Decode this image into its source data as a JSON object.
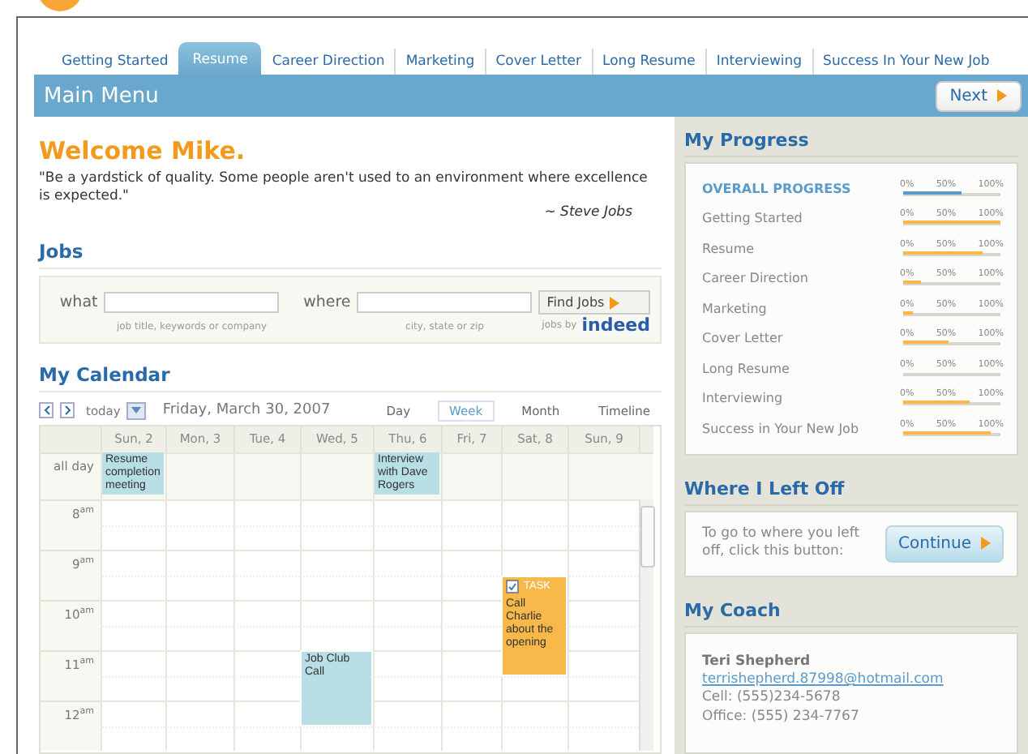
{
  "tabs": [
    {
      "label": "Getting Started",
      "selected": false
    },
    {
      "label": "Resume",
      "selected": true
    },
    {
      "label": "Career Direction",
      "selected": false
    },
    {
      "label": "Marketing",
      "selected": false
    },
    {
      "label": "Cover Letter",
      "selected": false
    },
    {
      "label": "Long Resume",
      "selected": false
    },
    {
      "label": "Interviewing",
      "selected": false
    },
    {
      "label": "Success In Your New Job",
      "selected": false
    }
  ],
  "menu_bar": {
    "title": "Main Menu",
    "next_button": "Next"
  },
  "welcome": {
    "title": "Welcome Mike.",
    "quote": "\"Be a yardstick of quality. Some people aren't used to an environment where excellence is expected.\"",
    "author": "~ Steve Jobs"
  },
  "jobs": {
    "title": "Jobs",
    "what": {
      "label": "what",
      "hint": "job title, keywords or company"
    },
    "where": {
      "label": "where",
      "hint": "city, state or zip"
    },
    "find_button": "Find Jobs",
    "jobs_by": "jobs by",
    "provider": "indeed"
  },
  "calendar": {
    "title": "My Calendar",
    "today": "today",
    "date": "Friday, March 30, 2007",
    "views": [
      {
        "label": "Day",
        "selected": false
      },
      {
        "label": "Week",
        "selected": true
      },
      {
        "label": "Month",
        "selected": false
      },
      {
        "label": "Timeline",
        "selected": false
      }
    ],
    "all_day_label": "all day",
    "hours": [
      {
        "label": "8$^{am}$"
      },
      {
        "label": "9$^{am}$"
      },
      {
        "label": "10$^{am}$"
      },
      {
        "label": "11$^{am}$"
      },
      {
        "label": "12$^{am}$"
      }
    ],
    "days": [
      {
        "label": "Sun, 2",
        "all_day": [
          "Resume completion meeting"
        ]
      },
      {
        "label": "Mon, 3"
      },
      {
        "label": "Tue, 4"
      },
      {
        "label": "Wed, 5",
        "slots": [
          {
            "kind": "empty"
          },
          {
            "kind": "empty"
          },
          {
            "kind": "empty"
          },
          {
            "kind": "empty"
          },
          {
            "kind": "empty"
          },
          {
            "kind": "empty"
          },
          {
            "kind": "event",
            "title": "Job Club Call"
          },
          {
            "kind": "continued"
          },
          {
            "kind": "continued"
          }
        ]
      },
      {
        "label": "Thu, 6",
        "all_day": [
          "Interview with Dave Rogers"
        ]
      },
      {
        "label": "Fri, 7"
      },
      {
        "label": "Sat, 8",
        "slots": [
          {
            "kind": "empty"
          },
          {
            "kind": "empty"
          },
          {
            "kind": "empty"
          },
          {
            "kind": "task",
            "tag": "TASK",
            "title": "Call Charlie about the opening"
          },
          {
            "kind": "continued"
          },
          {
            "kind": "continued"
          },
          {
            "kind": "continued"
          }
        ]
      },
      {
        "label": "Sun, 9"
      }
    ]
  },
  "progress": {
    "title": "My Progress",
    "items": [
      {
        "kind": "overall",
        "label": "OVERALL PROGRESS",
        "ticks": [
          "0%",
          "50%",
          "100%"
        ],
        "level": 0.6
      },
      {
        "kind": "section",
        "label": "Getting Started",
        "ticks": [
          "0%",
          "50%",
          "100%"
        ],
        "level": 1.0
      },
      {
        "kind": "section",
        "label": "Resume",
        "ticks": [
          "0%",
          "50%",
          "100%"
        ],
        "level": 0.82
      },
      {
        "kind": "section",
        "label": "Career Direction",
        "ticks": [
          "0%",
          "50%",
          "100%"
        ],
        "level": 0.18
      },
      {
        "kind": "section",
        "label": "Marketing",
        "ticks": [
          "0%",
          "50%",
          "100%"
        ],
        "level": 0.1
      },
      {
        "kind": "section",
        "label": "Cover Letter",
        "ticks": [
          "0%",
          "50%",
          "100%"
        ],
        "level": 0.47
      },
      {
        "kind": "section",
        "label": "Long Resume",
        "ticks": [
          "0%",
          "50%",
          "100%"
        ],
        "level": 0
      },
      {
        "kind": "section",
        "label": "Interviewing",
        "ticks": [
          "0%",
          "50%",
          "100%"
        ],
        "level": 0.68
      },
      {
        "kind": "section",
        "label": "Success in Your New Job",
        "ticks": [
          "0%",
          "50%",
          "100%"
        ],
        "level": 0.9
      }
    ]
  },
  "left_off": {
    "title": "Where I Left Off",
    "text": "To go to where you left off, click this button:",
    "button": "Continue"
  },
  "coach": {
    "title": "My Coach",
    "name": "Teri Shepherd",
    "email": "terrishepherd.87998@hotmail.com",
    "cell": "Cell: (555)234-5678",
    "office": "Office: (555) 234-7767"
  }
}
